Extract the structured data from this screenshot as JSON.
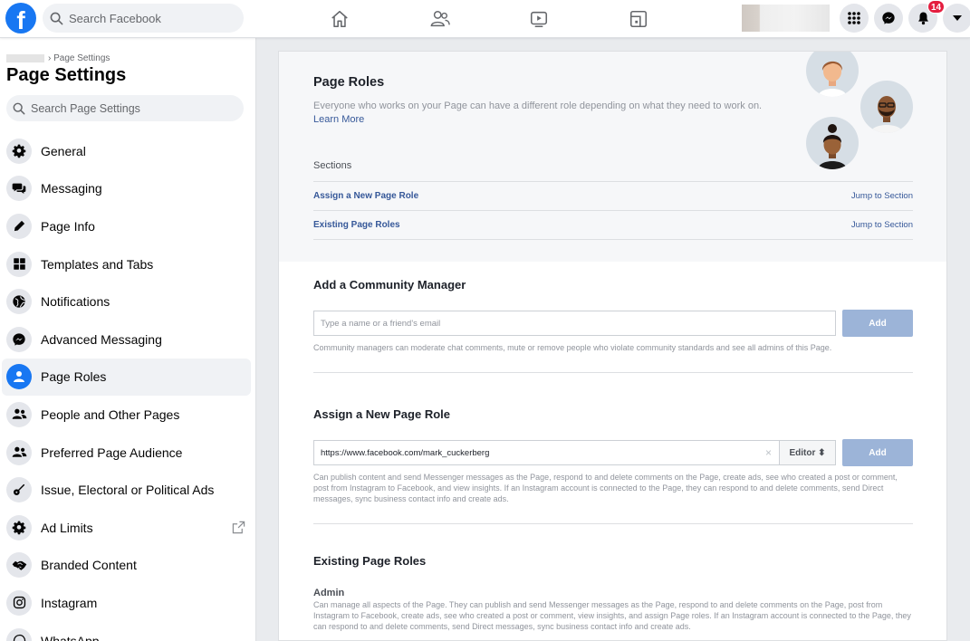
{
  "topbar": {
    "logo": "f",
    "search_placeholder": "Search Facebook",
    "notifications_count": "14",
    "nav_icons": [
      "home-icon",
      "friends-icon",
      "watch-icon",
      "gaming-icon"
    ],
    "right_icons": [
      "menu-grid-icon",
      "messenger-icon",
      "bell-icon",
      "caret-down-icon"
    ]
  },
  "sidebar": {
    "breadcrumb": "Page Settings",
    "title": "Page Settings",
    "search_placeholder": "Search Page Settings",
    "items": [
      {
        "label": "General",
        "icon": "gear-icon"
      },
      {
        "label": "Messaging",
        "icon": "chat-icon"
      },
      {
        "label": "Page Info",
        "icon": "pencil-icon"
      },
      {
        "label": "Templates and Tabs",
        "icon": "grid-icon"
      },
      {
        "label": "Notifications",
        "icon": "globe-icon"
      },
      {
        "label": "Advanced Messaging",
        "icon": "messenger-icon"
      },
      {
        "label": "Page Roles",
        "icon": "person-icon",
        "active": true
      },
      {
        "label": "People and Other Pages",
        "icon": "people-icon"
      },
      {
        "label": "Preferred Page Audience",
        "icon": "people-icon"
      },
      {
        "label": "Issue, Electoral or Political Ads",
        "icon": "guitar-icon"
      },
      {
        "label": "Ad Limits",
        "icon": "gear-icon"
      },
      {
        "label": "Branded Content",
        "icon": "handshake-icon"
      },
      {
        "label": "Instagram",
        "icon": "instagram-icon"
      },
      {
        "label": "WhatsApp",
        "icon": "whatsapp-icon"
      }
    ]
  },
  "intro": {
    "title": "Page Roles",
    "description": "Everyone who works on your Page can have a different role depending on what they need to work on.",
    "learn_more": "Learn More",
    "sections_label": "Sections",
    "sections": [
      {
        "label": "Assign a New Page Role",
        "jump": "Jump to Section"
      },
      {
        "label": "Existing Page Roles",
        "jump": "Jump to Section"
      }
    ]
  },
  "community": {
    "title": "Add a Community Manager",
    "placeholder": "Type a name or a friend's email",
    "add_label": "Add",
    "help": "Community managers can moderate chat comments, mute or remove people who violate community standards and see all admins of this Page."
  },
  "assign": {
    "title": "Assign a New Page Role",
    "value": "https://www.facebook.com/mark_cuckerberg",
    "clear": "×",
    "role": "Editor ⬍",
    "add_label": "Add",
    "help": "Can publish content and send Messenger messages as the Page, respond to and delete comments on the Page, create ads, see who created a post or comment, post from Instagram to Facebook, and view insights. If an Instagram account is connected to the Page, they can respond to and delete comments, send Direct messages, sync business contact info and create ads."
  },
  "existing": {
    "title": "Existing Page Roles",
    "admin_title": "Admin",
    "admin_help": "Can manage all aspects of the Page. They can publish and send Messenger messages as the Page, respond to and delete comments on the Page, post from Instagram to Facebook, create ads, see who created a post or comment, view insights, and assign Page roles. If an Instagram account is connected to the Page, they can respond to and delete comments, send Direct messages, sync business contact info and create ads."
  },
  "colors": {
    "brand": "#1877f2",
    "link": "#365899",
    "button_disabled": "#9cb4d8",
    "badge": "#e41e3f"
  }
}
